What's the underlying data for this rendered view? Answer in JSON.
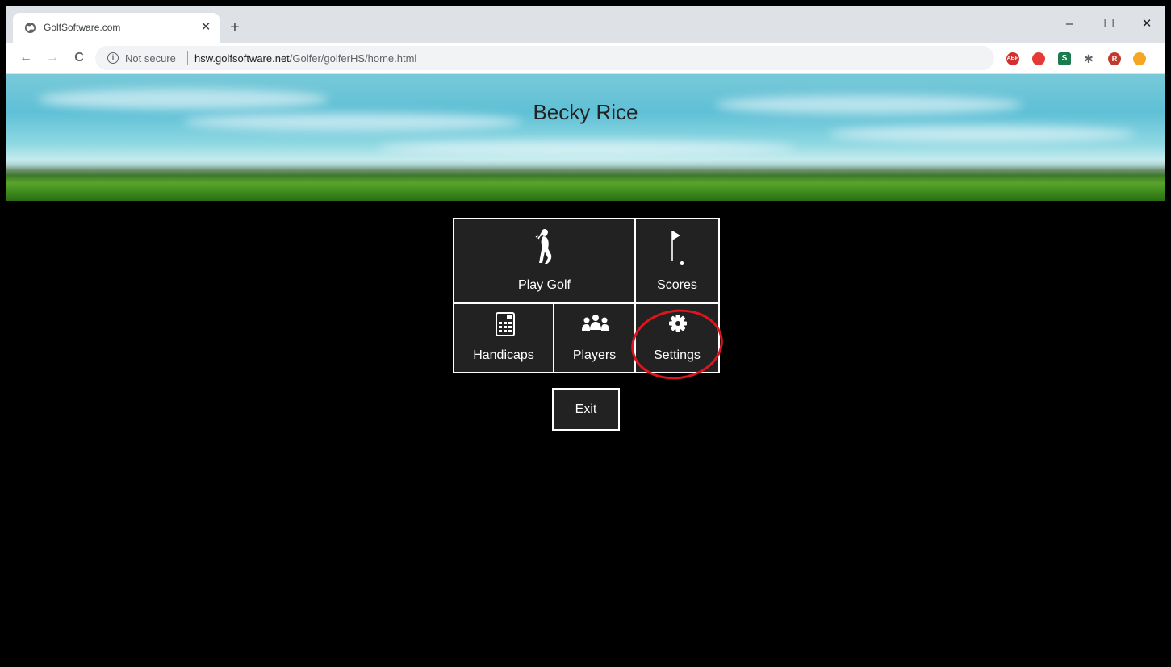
{
  "browser": {
    "tab_title": "GolfSoftware.com",
    "tab_close": "✕",
    "new_tab": "+",
    "window_controls": {
      "minimize": "–",
      "maximize": "☐",
      "close": "✕"
    },
    "nav": {
      "back": "←",
      "forward": "→",
      "reload": "C"
    },
    "security_label": "Not secure",
    "url_host": "hsw.golfsoftware.net",
    "url_path": "/Golfer/golferHS/home.html",
    "bookmark_icon": "☆",
    "extensions": [
      {
        "name": "adblock-plus-extension-icon",
        "text": "ABP",
        "color": "#d32f2f"
      },
      {
        "name": "pdf-extension-icon",
        "text": "",
        "color": "#e53935"
      },
      {
        "name": "s-extension-icon",
        "text": "S",
        "color": "#1b7a4e"
      },
      {
        "name": "puzzle-extensions-icon",
        "text": "✱",
        "color": "#5f6368"
      },
      {
        "name": "profile-avatar",
        "text": "R",
        "color": "#c0392b"
      },
      {
        "name": "update-extension-icon",
        "text": "",
        "color": "#f5a623"
      }
    ]
  },
  "header": {
    "title": "Becky Rice"
  },
  "menu": {
    "play_golf": {
      "label": "Play Golf",
      "icon": "golfer-icon"
    },
    "scores": {
      "label": "Scores",
      "icon": "flag-icon"
    },
    "handicaps": {
      "label": "Handicaps",
      "icon": "calculator-icon"
    },
    "players": {
      "label": "Players",
      "icon": "group-icon"
    },
    "settings": {
      "label": "Settings",
      "icon": "gear-icon"
    },
    "exit": {
      "label": "Exit"
    }
  },
  "colors": {
    "tile_bg": "#222222",
    "tile_border": "#ffffff",
    "highlight": "#e0141e",
    "page_bg": "#000000"
  }
}
